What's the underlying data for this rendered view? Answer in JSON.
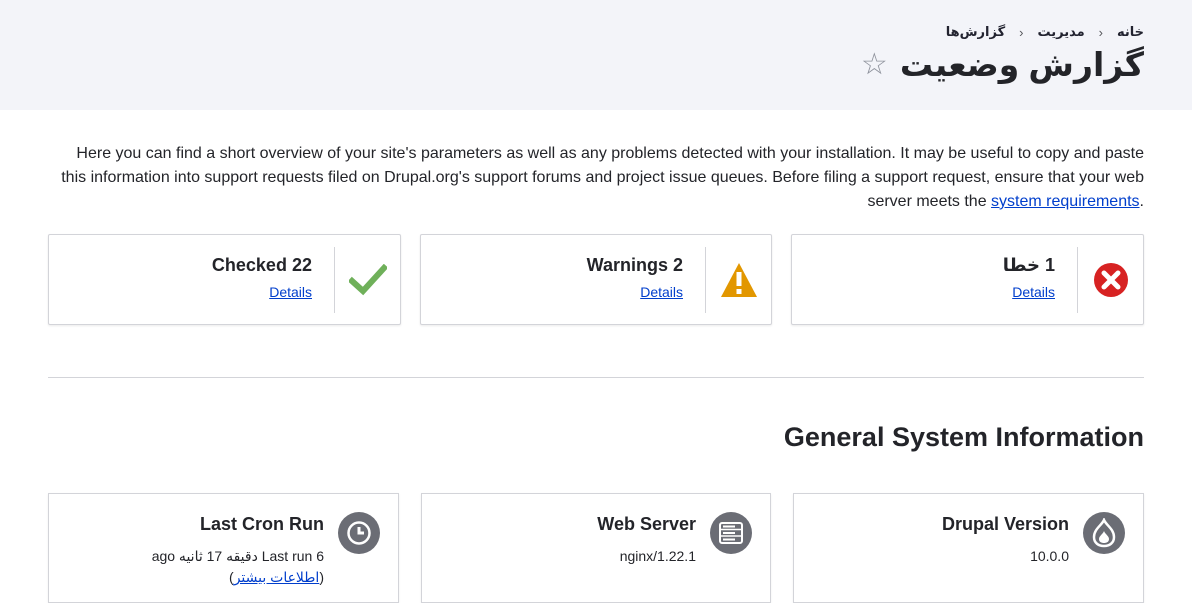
{
  "breadcrumb": {
    "items": [
      "خانه",
      "مدیریت",
      "گزارش‌ها"
    ],
    "separator": "‹"
  },
  "page": {
    "title": "گزارش وضعیت",
    "favorite_icon": "star-outline-icon"
  },
  "intro": {
    "text_before": "Here you can find a short overview of your site's parameters as well as any problems detected with your installation. It may be useful to copy and paste this information into support requests filed on Drupal.org's support forums and project issue queues. Before filing a support request, ensure that your web server meets the ",
    "link": "system requirements",
    "text_after": "."
  },
  "status_cards": [
    {
      "label": "1 خطا",
      "details": "Details",
      "icon": "error-icon",
      "color": "#d72222"
    },
    {
      "label": "2 Warnings",
      "details": "Details",
      "icon": "warning-icon",
      "color": "#e29700"
    },
    {
      "label": "22 Checked",
      "details": "Details",
      "icon": "checked-icon",
      "color": "#42a877"
    }
  ],
  "general": {
    "title": "General System Information",
    "cards": [
      {
        "title": "Drupal Version",
        "value": "10.0.0",
        "icon": "drupal-icon"
      },
      {
        "title": "Web Server",
        "value": "nginx/1.22.1",
        "icon": "server-icon"
      },
      {
        "title": "Last Cron Run",
        "value": "Last run 6 دقیقه 17 ثانیه ago",
        "link": "اطلاعات بیشتر",
        "icon": "clock-icon"
      }
    ]
  }
}
